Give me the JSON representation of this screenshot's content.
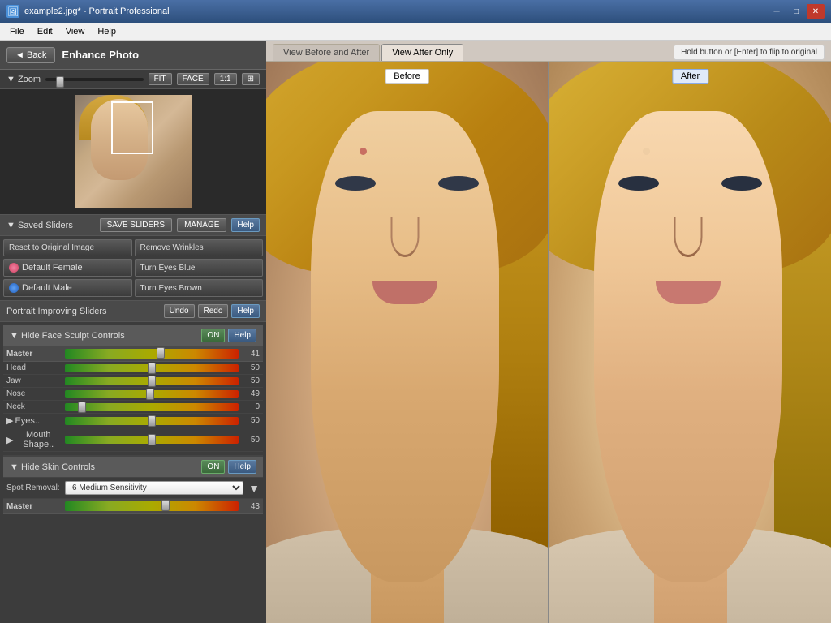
{
  "titlebar": {
    "title": "example2.jpg* - Portrait Professional",
    "icon": "PP"
  },
  "menubar": {
    "items": [
      "File",
      "Edit",
      "View",
      "Help"
    ]
  },
  "panel": {
    "back_label": "◄ Back",
    "title": "Enhance Photo",
    "zoom_label": "▼ Zoom",
    "zoom_fit": "FIT",
    "zoom_face": "FACE",
    "zoom_1to1": "1:1",
    "saved_sliders_label": "▼ Saved Sliders",
    "save_sliders_label": "SAVE SLIDERS",
    "manage_label": "MANAGE",
    "help_label": "Help",
    "reset_label": "Reset to Original Image",
    "remove_wrinkles_label": "Remove Wrinkles",
    "default_female_label": "Default Female",
    "turn_eyes_blue_label": "Turn Eyes Blue",
    "default_male_label": "Default Male",
    "turn_eyes_brown_label": "Turn Eyes Brown",
    "portrait_title": "Portrait Improving Sliders",
    "undo_label": "Undo",
    "redo_label": "Redo",
    "help2_label": "Help",
    "hide_face_label": "▼ Hide Face Sculpt Controls",
    "on_label": "ON",
    "help3_label": "Help",
    "sliders": [
      {
        "label": "Master",
        "value": 41,
        "pct": 55,
        "is_master": true
      },
      {
        "label": "Head",
        "value": 50,
        "pct": 50
      },
      {
        "label": "Jaw",
        "value": 50,
        "pct": 50
      },
      {
        "label": "Nose",
        "value": 49,
        "pct": 49
      },
      {
        "label": "Neck",
        "value": 0,
        "pct": 10
      }
    ],
    "expand_sliders": [
      {
        "label": "Eyes..",
        "value": 50,
        "pct": 50
      },
      {
        "label": "Mouth Shape..",
        "value": 50,
        "pct": 50
      }
    ],
    "skin_controls_label": "▼ Hide Skin Controls",
    "on2_label": "ON",
    "help4_label": "Help",
    "spot_removal_label": "Spot Removal:",
    "spot_removal_value": "6 Medium Sensitivity",
    "skin_master_label": "Master",
    "skin_master_value": 43,
    "skin_master_pct": 58
  },
  "view": {
    "before_after_label": "View Before and After",
    "after_only_label": "View After Only",
    "flip_hint": "Hold button or [Enter] to flip to original",
    "before_label": "Before",
    "after_label": "After"
  }
}
